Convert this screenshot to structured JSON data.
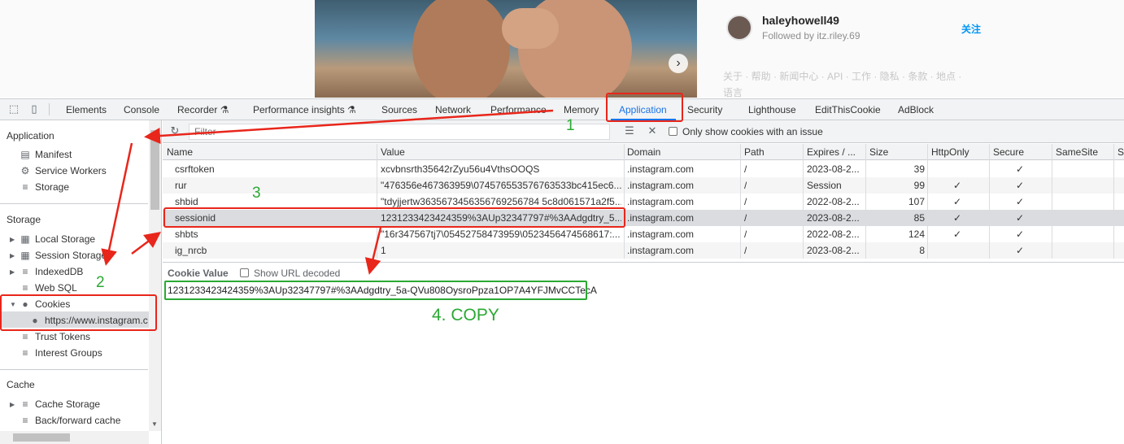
{
  "instagram": {
    "username": "haleyhowell49",
    "followed_by": "Followed by itz.riley.69",
    "follow_label": "关注",
    "footer_links": "关于 · 帮助 · 新闻中心 · API · 工作 · 隐私 · 条款 · 地点 · 语言"
  },
  "devtools": {
    "tabs": [
      {
        "label": "Elements"
      },
      {
        "label": "Console"
      },
      {
        "label": "Recorder ⚗"
      },
      {
        "label": "Performance insights ⚗"
      },
      {
        "label": "Sources"
      },
      {
        "label": "Network"
      },
      {
        "label": "Performance"
      },
      {
        "label": "Memory"
      },
      {
        "label": "Application",
        "active": true
      },
      {
        "label": "Security"
      },
      {
        "label": "Lighthouse"
      },
      {
        "label": "EditThisCookie"
      },
      {
        "label": "AdBlock"
      }
    ],
    "sidebar": {
      "application_heading": "Application",
      "application_items": [
        "Manifest",
        "Service Workers",
        "Storage"
      ],
      "storage_heading": "Storage",
      "storage_items": [
        "Local Storage",
        "Session Storage",
        "IndexedDB",
        "Web SQL",
        "Cookies"
      ],
      "cookie_origin": "https://www.instagram.c",
      "storage_items_after": [
        "Trust Tokens",
        "Interest Groups"
      ],
      "cache_heading": "Cache",
      "cache_items": [
        "Cache Storage",
        "Back/forward cache"
      ]
    },
    "toolbar": {
      "filter_placeholder": "Filter",
      "only_issue_label": "Only show cookies with an issue"
    },
    "table": {
      "columns": [
        "Name",
        "Value",
        "Domain",
        "Path",
        "Expires / ...",
        "Size",
        "HttpOnly",
        "Secure",
        "SameSite",
        "Sa"
      ],
      "rows": [
        {
          "name": "csrftoken",
          "value": "xcvbnsrth35642rZyu56u4VthsOOQS",
          "domain": ".instagram.com",
          "path": "/",
          "expires": "2023-08-2...",
          "size": "39",
          "httponly": "",
          "secure": "✓"
        },
        {
          "name": "rur",
          "value": "\"476356e467363959\\074576553576763533bc415ec6...",
          "domain": ".instagram.com",
          "path": "/",
          "expires": "Session",
          "size": "99",
          "httponly": "✓",
          "secure": "✓"
        },
        {
          "name": "shbid",
          "value": "\"tdyjjertw3635673456356769256784 5c8d061571a2f5...",
          "domain": ".instagram.com",
          "path": "/",
          "expires": "2022-08-2...",
          "size": "107",
          "httponly": "✓",
          "secure": "✓"
        },
        {
          "name": "sessionid",
          "value": "1231233423424359%3AUp32347797#%3AAdgdtry_5...",
          "domain": ".instagram.com",
          "path": "/",
          "expires": "2023-08-2...",
          "size": "85",
          "httponly": "✓",
          "secure": "✓"
        },
        {
          "name": "shbts",
          "value": "\"16r347567tj7\\05452758473959\\0523456474568617:...",
          "domain": ".instagram.com",
          "path": "/",
          "expires": "2022-08-2...",
          "size": "124",
          "httponly": "✓",
          "secure": "✓"
        },
        {
          "name": "ig_nrcb",
          "value": "1",
          "domain": ".instagram.com",
          "path": "/",
          "expires": "2023-08-2...",
          "size": "8",
          "httponly": "",
          "secure": "✓"
        }
      ]
    },
    "detail": {
      "label": "Cookie Value",
      "show_url_decoded": "Show URL decoded",
      "value": "1231233423424359%3AUp32347797#%3AAdgdtry_5a-QVu808OysroPpza1OP7A4YFJMvCCTecA"
    }
  },
  "annotations": {
    "step1": "1",
    "step2": "2",
    "step3": "3",
    "step4_num": "4.",
    "step4_text": "COPY",
    "red": "#e8261b",
    "green": "#2ba934"
  }
}
